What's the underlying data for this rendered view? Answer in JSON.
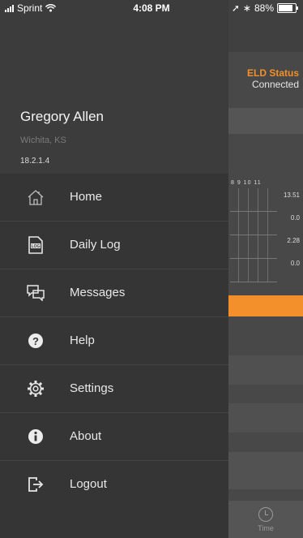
{
  "status_bar": {
    "carrier": "Sprint",
    "time": "4:08 PM",
    "battery": "88%",
    "battery_level": 0.88
  },
  "profile": {
    "name": "Gregory Allen",
    "location": "Wichita, KS",
    "version": "18.2.1.4"
  },
  "menu": {
    "items": [
      {
        "label": "Home",
        "icon": "home-icon"
      },
      {
        "label": "Daily Log",
        "icon": "log-icon"
      },
      {
        "label": "Messages",
        "icon": "messages-icon"
      },
      {
        "label": "Help",
        "icon": "help-icon"
      },
      {
        "label": "Settings",
        "icon": "gear-icon"
      },
      {
        "label": "About",
        "icon": "info-icon"
      },
      {
        "label": "Logout",
        "icon": "logout-icon"
      }
    ]
  },
  "background": {
    "eld_title": "ELD Status",
    "eld_value": "Connected",
    "hours_header": "8  9  10 11",
    "hour_values": [
      "13.51",
      "0.0",
      "2.28",
      "0.0"
    ],
    "time_tab": "Time"
  },
  "colors": {
    "accent": "#f4902b",
    "drawer": "#353535",
    "text": "#e8e8e8"
  }
}
